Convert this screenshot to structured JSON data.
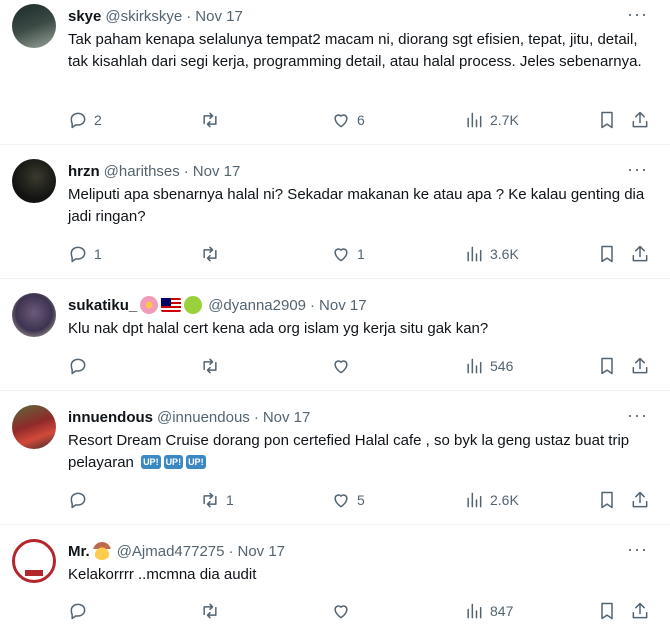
{
  "tweets": [
    {
      "name": "skye",
      "handle": "@skirkskye",
      "date": "Nov 17",
      "text": "Tak paham kenapa selalunya tempat2 macam ni, diorang sgt efisien, tepat, jitu, detail, tak kisahlah dari segi kerja, programming detail, atau halal process. Jeles sebenarnya.",
      "replies": "2",
      "retweets": "",
      "likes": "6",
      "views": "2.7K"
    },
    {
      "name": "hrzn",
      "handle": "@harithses",
      "date": "Nov 17",
      "text": "Meliputi apa sbenarnya halal ni? Sekadar makanan ke atau apa ? Ke kalau genting dia jadi ringan?",
      "replies": "1",
      "retweets": "",
      "likes": "1",
      "views": "3.6K"
    },
    {
      "name": "sukatiku_",
      "handle": "@dyanna2909",
      "date": "Nov 17",
      "text": "Klu nak dpt halal cert kena ada org islam yg kerja situ gak kan?",
      "replies": "",
      "retweets": "",
      "likes": "",
      "views": "546"
    },
    {
      "name": "innuendous",
      "handle": "@innuendous",
      "date": "Nov 17",
      "text": "Resort Dream Cruise dorang pon certefied Halal cafe , so byk la geng ustaz buat trip pelayaran",
      "up_labels": [
        "UP!",
        "UP!",
        "UP!"
      ],
      "replies": "",
      "retweets": "1",
      "likes": "5",
      "views": "2.6K"
    },
    {
      "name": "Mr.",
      "handle": "@Ajmad477275",
      "date": "Nov 17",
      "text": "Kelakorrrr ..mcmna dia audit",
      "replies": "",
      "retweets": "",
      "likes": "",
      "views": "847"
    }
  ],
  "icons": {
    "reply": "reply-icon",
    "retweet": "retweet-icon",
    "like": "heart-icon",
    "views": "views-icon",
    "bookmark": "bookmark-icon",
    "share": "share-icon",
    "more": "more-icon"
  },
  "colors": {
    "text": "#0f1419",
    "secondary": "#536471",
    "divider": "#eff3f4",
    "up_badge": "#3b88c3"
  }
}
